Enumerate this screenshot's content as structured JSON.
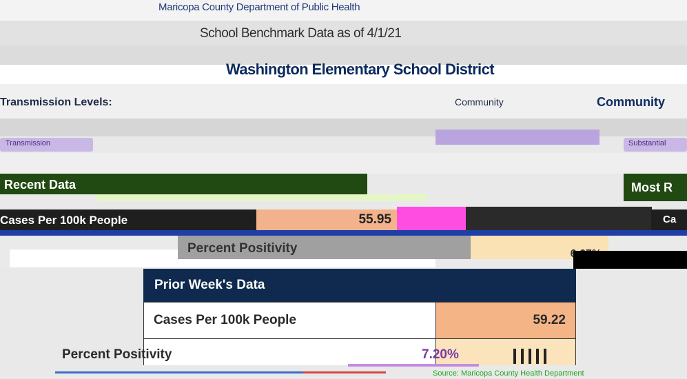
{
  "header": {
    "top_title": "Maricopa County Department of Public Health",
    "top_left": "",
    "subtitle": "School Benchmark Data as of 4/1/21",
    "school_name": "Washington Elementary School District",
    "school_left_tag": ""
  },
  "transmission": {
    "label": "Transmission Levels:",
    "right_text": "Community",
    "right_text_2": "Community",
    "chip_left": "Transmission",
    "chip_right": "Substantial"
  },
  "recent": {
    "header": "Recent Data",
    "cases_label": "Cases Per 100k People",
    "cases_value": "55.95",
    "percent_label": "Percent Positivity",
    "percent_value": "6.67%"
  },
  "most_recent": {
    "header": "Most R",
    "cases_label": "Ca"
  },
  "prior_week": {
    "header": "Prior Week's Data",
    "cases_label": "Cases Per 100k People",
    "cases_value": "59.22",
    "percent_label": "Percent Positivity",
    "percent_value": "7.20%"
  },
  "footer": {
    "source": "Source: Maricopa County Health Department"
  },
  "colors": {
    "navy": "#0f2a4e",
    "green_header": "#214a12",
    "peach": "#f4b486",
    "light_peach": "#fbe3bb",
    "source_green": "#22a41c"
  }
}
